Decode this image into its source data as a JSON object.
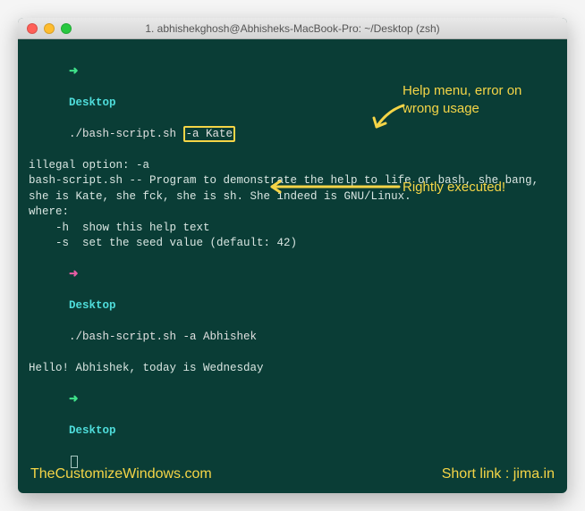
{
  "window": {
    "title": "1. abhishekghosh@Abhisheks-MacBook-Pro: ~/Desktop (zsh)"
  },
  "terminal": {
    "line1": {
      "arrow": "➜",
      "cwd": "Desktop",
      "cmd_prefix": "./bash-script.sh ",
      "cmd_highlight": "-a Kate"
    },
    "line2": "illegal option: -a",
    "line3": "bash-script.sh -- Program to demonstrate the help to life or bash, she bang, she is Kate, she fck, she is sh. She indeed is GNU/Linux.",
    "line4": "",
    "line5": "where:",
    "line6": "    -h  show this help text",
    "line7": "    -s  set the seed value (default: 42)",
    "line8": {
      "arrow": "➜",
      "cwd": "Desktop",
      "cmd": "./bash-script.sh -a Abhishek"
    },
    "line9": "Hello! Abhishek, today is Wednesday",
    "line10": {
      "arrow": "➜",
      "cwd": "Desktop"
    }
  },
  "annotations": {
    "a1": "Help menu, error on wrong usage",
    "a2": "Rightly executed!"
  },
  "footer": {
    "left": "TheCustomizeWindows.com",
    "right": "Short link : jima.in"
  }
}
